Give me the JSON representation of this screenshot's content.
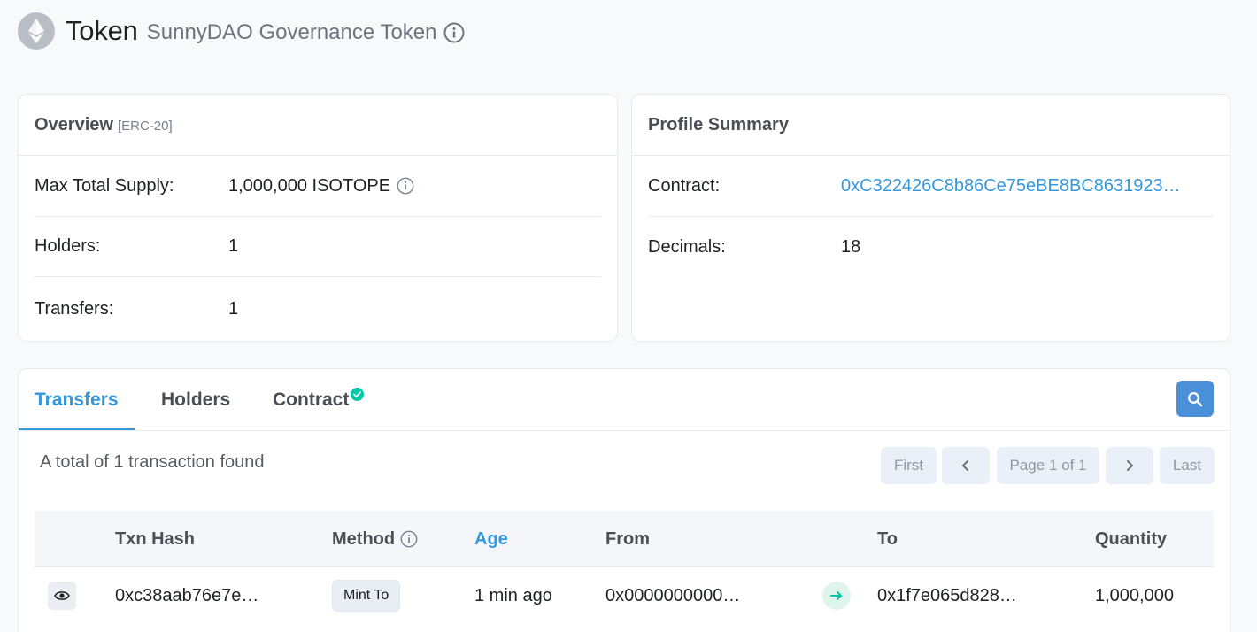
{
  "header": {
    "logo_icon": "ethereum-icon",
    "title": "Token",
    "subtitle": "SunnyDAO Governance Token",
    "info_icon": "info-circle-icon"
  },
  "overview": {
    "title": "Overview",
    "badge": "[ERC-20]",
    "rows": [
      {
        "label": "Max Total Supply:",
        "value": "1,000,000 ISOTOPE"
      },
      {
        "label": "Holders:",
        "value": "1"
      },
      {
        "label": "Transfers:",
        "value": "1"
      }
    ]
  },
  "profile": {
    "title": "Profile Summary",
    "rows": [
      {
        "label": "Contract:",
        "value": "0xC322426C8b86Ce75eBE8BC8631923…"
      },
      {
        "label": "Decimals:",
        "value": "18"
      }
    ]
  },
  "tabs": {
    "items": [
      {
        "label": "Transfers",
        "active": true
      },
      {
        "label": "Holders",
        "active": false
      },
      {
        "label": "Contract",
        "active": false,
        "verified": true
      }
    ],
    "search_icon": "search-icon"
  },
  "transfers": {
    "total_text": "A total of 1 transaction found",
    "pager": {
      "first": "First",
      "prev": "‹",
      "page": "Page 1 of 1",
      "next": "›",
      "last": "Last"
    },
    "columns": [
      "Txn Hash",
      "Method",
      "Age",
      "From",
      "To",
      "Quantity"
    ],
    "rows": [
      {
        "txn_hash": "0xc38aab76e7e…",
        "method": "Mint To",
        "age": "1 min ago",
        "from": "0x0000000000…",
        "to": "0x1f7e065d828…",
        "quantity": "1,000,000"
      }
    ]
  },
  "colors": {
    "accent": "#3498db",
    "success": "#00c9a7",
    "background": "#f8f9fa"
  }
}
